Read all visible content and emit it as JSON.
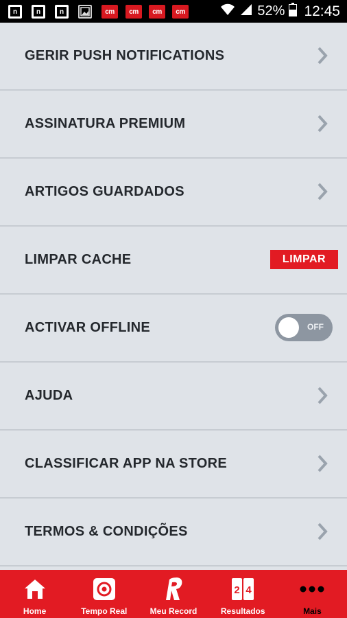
{
  "status_bar": {
    "battery_percent": "52%",
    "time": "12:45",
    "notifications": [
      {
        "type": "letter",
        "glyph": "n"
      },
      {
        "type": "letter",
        "glyph": "n"
      },
      {
        "type": "letter",
        "glyph": "n"
      },
      {
        "type": "image",
        "glyph": "image-icon"
      },
      {
        "type": "brand",
        "glyph": "cm"
      },
      {
        "type": "brand",
        "glyph": "cm"
      },
      {
        "type": "brand",
        "glyph": "cm"
      },
      {
        "type": "brand",
        "glyph": "cm"
      }
    ]
  },
  "menu": {
    "items": [
      {
        "label": "GERIR PUSH NOTIFICATIONS"
      },
      {
        "label": "ASSINATURA PREMIUM"
      },
      {
        "label": "ARTIGOS GUARDADOS"
      },
      {
        "label": "LIMPAR CACHE",
        "action_label": "LIMPAR"
      },
      {
        "label": "ACTIVAR OFFLINE",
        "toggle_label": "OFF"
      },
      {
        "label": "AJUDA"
      },
      {
        "label": "CLASSIFICAR APP NA STORE"
      },
      {
        "label": "TERMOS & CONDIÇÕES"
      }
    ]
  },
  "tabbar": {
    "tabs": [
      {
        "label": "Home",
        "icon": "home-icon"
      },
      {
        "label": "Tempo Real",
        "icon": "live-icon"
      },
      {
        "label": "Meu Record",
        "icon": "record-logo-icon"
      },
      {
        "label": "Resultados",
        "icon": "scoreboard-icon"
      },
      {
        "label": "Mais",
        "icon": "more-dots-icon"
      }
    ]
  },
  "colors": {
    "accent": "#e21b23",
    "background": "#dfe3e8",
    "divider": "#c7ccd2",
    "text": "#24282d",
    "chevron": "#9aa3ad",
    "toggle_off": "#8d96a1"
  }
}
